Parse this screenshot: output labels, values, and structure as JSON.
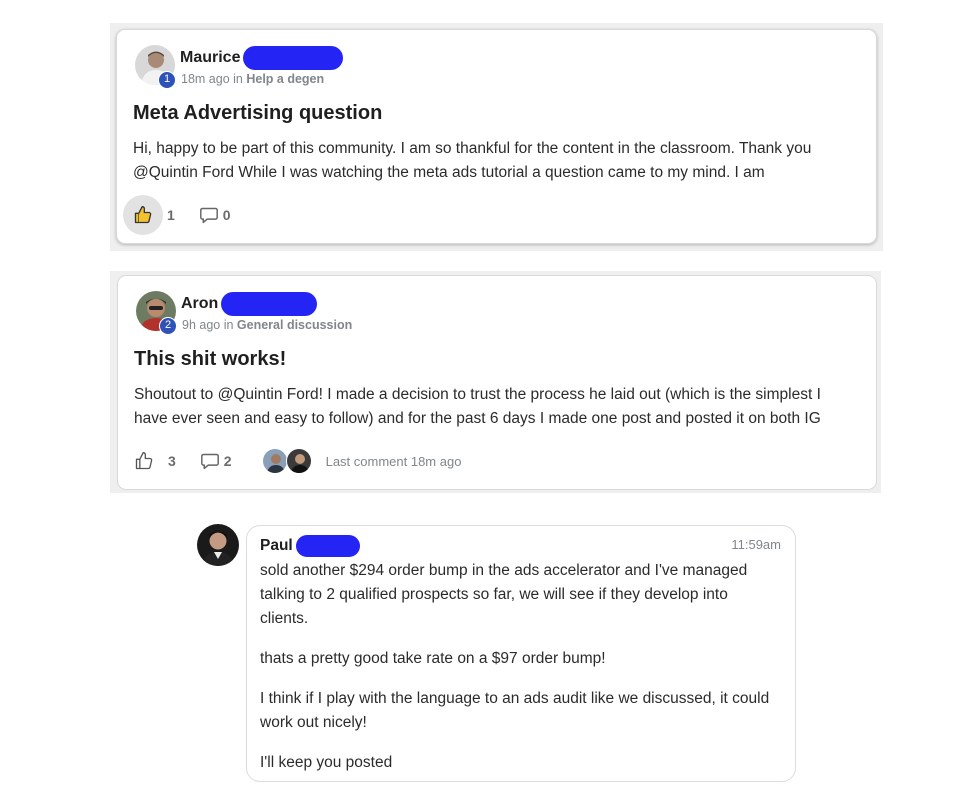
{
  "posts": [
    {
      "author": "Maurice",
      "level": "1",
      "time": "18m ago in",
      "category": "Help a degen",
      "title": "Meta Advertising question",
      "body": "Hi, happy to be part of this community. I am so thankful for the content in the classroom. Thank you @Quintin Ford While I was watching the meta ads tutorial a question came to my mind. I am",
      "likes": "1",
      "comments": "0",
      "liked": true
    },
    {
      "author": "Aron",
      "level": "2",
      "time": "9h ago in",
      "category": "General discussion",
      "title": "This shit works!",
      "body": "Shoutout to @Quintin Ford! I made a decision to trust the process he laid out (which is the simplest I have ever seen and easy to follow) and for the past 6 days I made one post and posted it on both IG",
      "likes": "3",
      "comments": "2",
      "last_comment": "Last comment 18m ago",
      "liked": false
    }
  ],
  "chat": {
    "author": "Paul",
    "time": "11:59am",
    "paragraphs": [
      "sold another $294 order bump in the ads accelerator and I've managed talking to 2 qualified prospects so far, we will see if they develop into clients.",
      "thats a pretty good take rate on a $97 order bump!",
      "I think if I play with the language to an ads audit like we discussed, it could work out nicely!",
      "I'll keep you posted"
    ]
  },
  "icons": {
    "like": "thumbs-up-icon",
    "comment": "speech-bubble-icon"
  },
  "colors": {
    "redaction": "#2424f5",
    "level_badge": "#2f52b8",
    "like_active_bg": "#e2e2e2"
  }
}
